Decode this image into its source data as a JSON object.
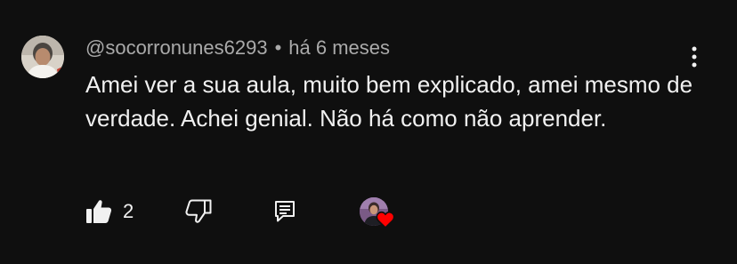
{
  "comment": {
    "author": "@socorronunes6293",
    "separator": "•",
    "time": "há 6 meses",
    "text": "Amei ver a sua aula, muito bem explicado, amei mesmo de verdade. Achei genial. Não há como não aprender.",
    "likes": "2",
    "icons": {
      "like": "thumbs-up-icon",
      "dislike": "thumbs-down-icon",
      "reply": "reply-icon",
      "menu": "more-vertical-icon",
      "hearted": "creator-heart-icon"
    },
    "colors": {
      "background": "#0f0f0f",
      "text": "#f1f1f1",
      "secondary": "#aaaaaa",
      "heart": "#ff0000"
    }
  }
}
